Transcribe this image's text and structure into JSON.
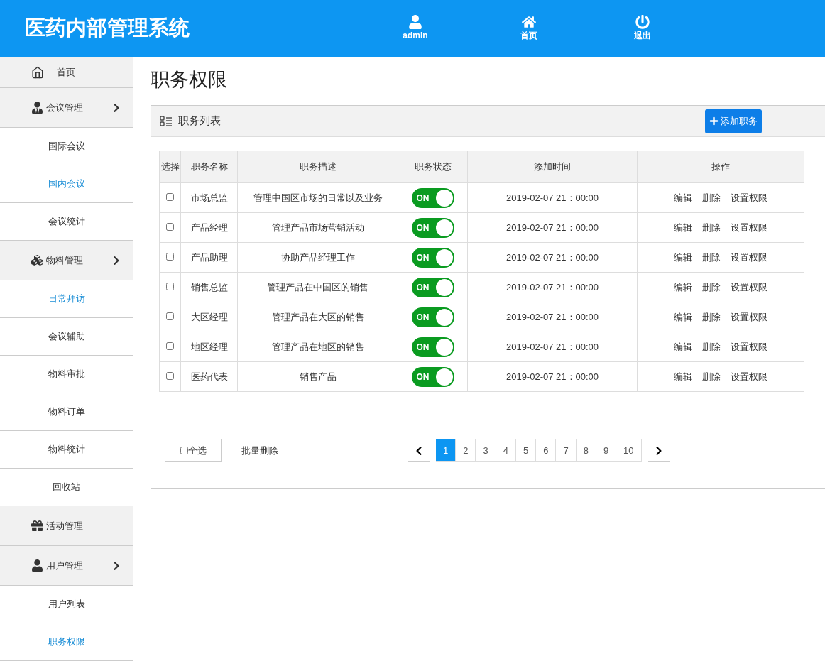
{
  "header": {
    "title": "医药内部管理系统",
    "nav": [
      {
        "label": "admin"
      },
      {
        "label": "首页"
      },
      {
        "label": "退出"
      }
    ]
  },
  "sidebar": {
    "items": [
      {
        "kind": "section",
        "label": "首页",
        "expandable": false
      },
      {
        "kind": "section",
        "label": "会议管理",
        "expandable": true
      },
      {
        "kind": "sub",
        "label": "国际会议",
        "selected": false
      },
      {
        "kind": "sub",
        "label": "国内会议",
        "selected": true
      },
      {
        "kind": "sub",
        "label": "会议统计",
        "selected": false
      },
      {
        "kind": "section",
        "label": "物料管理",
        "expandable": true
      },
      {
        "kind": "sub",
        "label": "日常拜访",
        "selected": true
      },
      {
        "kind": "sub",
        "label": "会议辅助",
        "selected": false
      },
      {
        "kind": "sub",
        "label": "物料审批",
        "selected": false
      },
      {
        "kind": "sub",
        "label": "物料订单",
        "selected": false
      },
      {
        "kind": "sub",
        "label": "物料统计",
        "selected": false
      },
      {
        "kind": "sub",
        "label": "回收站",
        "selected": false
      },
      {
        "kind": "section",
        "label": "活动管理",
        "expandable": false
      },
      {
        "kind": "section",
        "label": "用户管理",
        "expandable": true
      },
      {
        "kind": "sub",
        "label": "用户列表",
        "selected": false
      },
      {
        "kind": "sub",
        "label": "职务权限",
        "selected": true
      }
    ]
  },
  "page_title": "职务权限",
  "panel": {
    "title": "职务列表",
    "add_button": "添加职务"
  },
  "table": {
    "columns": [
      "选择",
      "职务名称",
      "职务描述",
      "职务状态",
      "添加时间",
      "操作"
    ],
    "rows": [
      {
        "checked": false,
        "name": "市场总监",
        "description": "管理中国区市场的日常以及业务",
        "status_on": true,
        "status_label": "ON",
        "time": "2019-02-07 21：00:00",
        "actions": [
          "编辑",
          "删除",
          "设置权限"
        ]
      },
      {
        "checked": false,
        "name": "产品经理",
        "description": "管理产品市场营销活动",
        "status_on": true,
        "status_label": "ON",
        "time": "2019-02-07 21：00:00",
        "actions": [
          "编辑",
          "删除",
          "设置权限"
        ]
      },
      {
        "checked": false,
        "name": "产品助理",
        "description": "协助产品经理工作",
        "status_on": true,
        "status_label": "ON",
        "time": "2019-02-07 21：00:00",
        "actions": [
          "编辑",
          "删除",
          "设置权限"
        ]
      },
      {
        "checked": false,
        "name": "销售总监",
        "description": "管理产品在中国区的销售",
        "status_on": true,
        "status_label": "ON",
        "time": "2019-02-07 21：00:00",
        "actions": [
          "编辑",
          "删除",
          "设置权限"
        ]
      },
      {
        "checked": false,
        "name": "大区经理",
        "description": "管理产品在大区的销售",
        "status_on": true,
        "status_label": "ON",
        "time": "2019-02-07 21：00:00",
        "actions": [
          "编辑",
          "删除",
          "设置权限"
        ]
      },
      {
        "checked": false,
        "name": "地区经理",
        "description": "管理产品在地区的销售",
        "status_on": true,
        "status_label": "ON",
        "time": "2019-02-07 21：00:00",
        "actions": [
          "编辑",
          "删除",
          "设置权限"
        ]
      },
      {
        "checked": false,
        "name": "医药代表",
        "description": "销售产品",
        "status_on": true,
        "status_label": "ON",
        "time": "2019-02-07 21：00:00",
        "actions": [
          "编辑",
          "删除",
          "设置权限"
        ]
      }
    ]
  },
  "footer": {
    "select_all": {
      "label": "全选",
      "checked": false
    },
    "batch_delete": "批量删除",
    "pages": [
      {
        "label": "1",
        "selected": true
      },
      {
        "label": "2",
        "selected": false
      },
      {
        "label": "3",
        "selected": false
      },
      {
        "label": "4",
        "selected": false
      },
      {
        "label": "5",
        "selected": false
      },
      {
        "label": "6",
        "selected": false
      },
      {
        "label": "7",
        "selected": false
      },
      {
        "label": "8",
        "selected": false
      },
      {
        "label": "9",
        "selected": false
      },
      {
        "label": "10",
        "selected": false
      }
    ]
  }
}
